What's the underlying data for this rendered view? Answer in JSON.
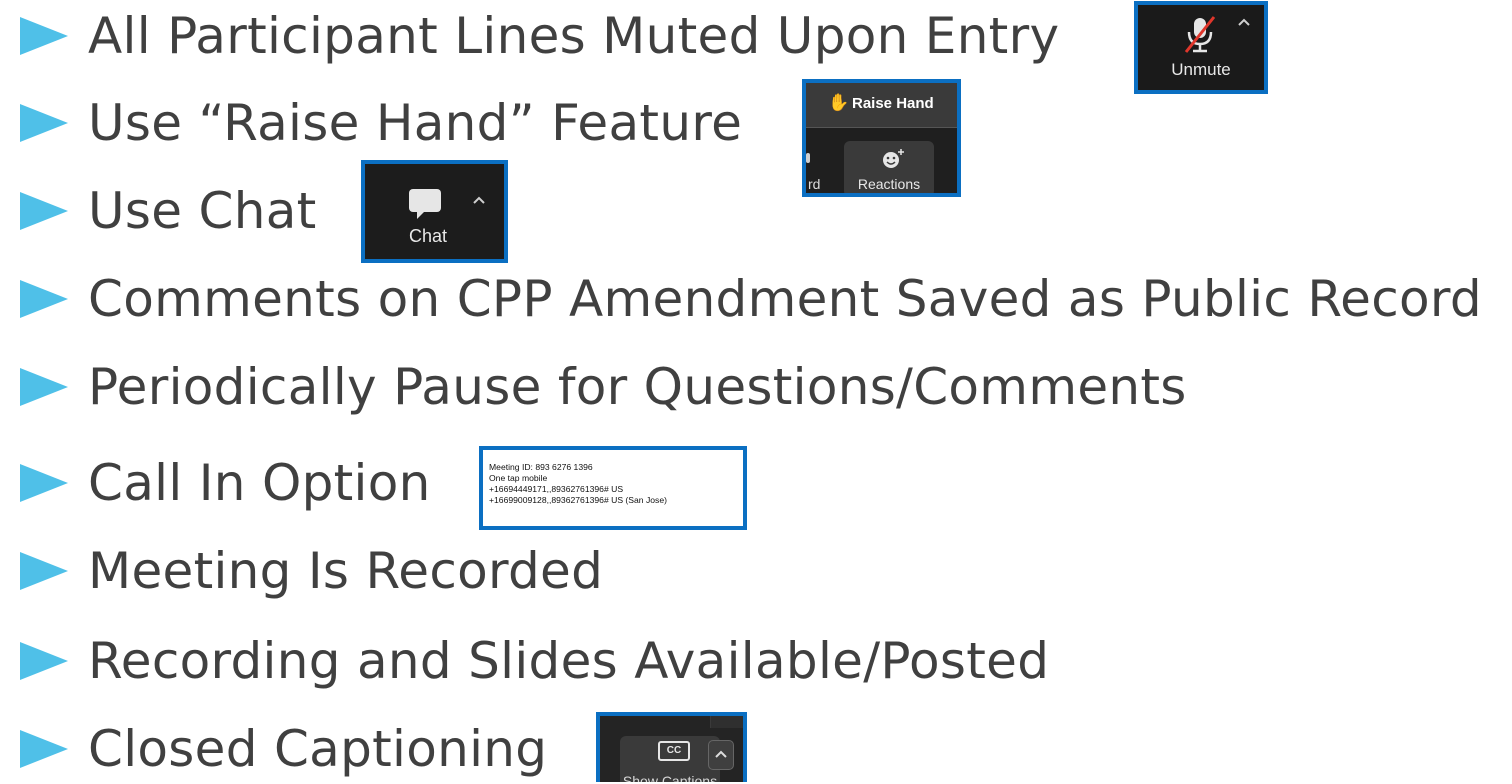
{
  "bullets": [
    "All Participant Lines Muted Upon Entry",
    "Use “Raise Hand” Feature",
    "Use Chat",
    "Comments on CPP Amendment Saved as Public Record",
    "Periodically Pause for Questions/Comments",
    "Call In Option",
    "Meeting Is Recorded",
    "Recording and Slides Available/Posted",
    "Closed Captioning"
  ],
  "unmute_shot": {
    "label": "Unmute",
    "icon": "muted-microphone-icon"
  },
  "raise_hand_shot": {
    "menu_label": "Raise Hand",
    "icon": "hand-icon",
    "reactions_label": "Reactions",
    "cut_label": "rd"
  },
  "chat_shot": {
    "label": "Chat",
    "icon": "chat-bubble-icon"
  },
  "call_in_shot": {
    "lines": [
      "Meeting ID: 893 6276 1396",
      "One tap mobile",
      "+16694449171,,89362761396# US",
      "+16699009128,,89362761396# US (San Jose)"
    ]
  },
  "captions_shot": {
    "icon_text": "CC",
    "label": "Show Captions"
  },
  "colors": {
    "bullet": "#4fc0e8",
    "text": "#404040",
    "frame": "#0b6fc2"
  }
}
